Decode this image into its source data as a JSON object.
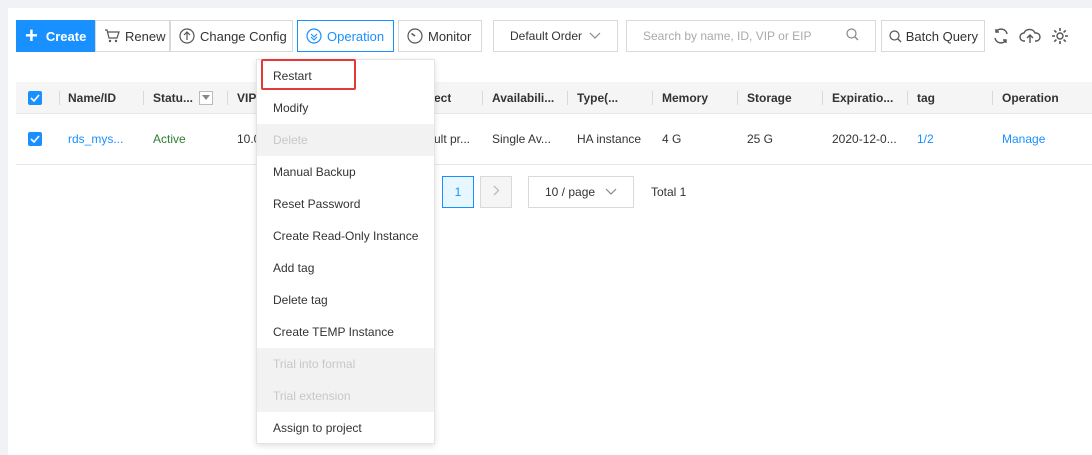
{
  "toolbar": {
    "create_label": "Create",
    "renew_label": "Renew",
    "change_config_label": "Change Config",
    "operation_label": "Operation",
    "monitor_label": "Monitor",
    "order_select_value": "Default Order",
    "search_placeholder": "Search by name, ID, VIP or EIP",
    "batch_query_label": "Batch Query"
  },
  "table": {
    "headers": {
      "name": "Name/ID",
      "status": "Statu...",
      "vip": "VIP",
      "project": "ect",
      "availability": "Availabili...",
      "type": "Type(...",
      "memory": "Memory",
      "storage": "Storage",
      "expiration": "Expiratio...",
      "tag": "tag",
      "operation": "Operation"
    },
    "row": {
      "name": "rds_mys...",
      "status": "Active",
      "vip": "10.0",
      "project": "ult pr...",
      "availability": "Single Av...",
      "type": "HA instance",
      "memory": "4 G",
      "storage": "25 G",
      "expiration": "2020-12-0...",
      "tag": "1/2",
      "operation": "Manage"
    }
  },
  "pagination": {
    "current_page": "1",
    "page_size": "10 / page",
    "total": "Total 1"
  },
  "menu": {
    "items": [
      {
        "label": "Restart"
      },
      {
        "label": "Modify"
      },
      {
        "label": "Delete"
      },
      {
        "label": "Manual Backup"
      },
      {
        "label": "Reset Password"
      },
      {
        "label": "Create Read-Only Instance"
      },
      {
        "label": "Add tag"
      },
      {
        "label": "Delete tag"
      },
      {
        "label": "Create TEMP Instance"
      },
      {
        "label": "Trial into formal"
      },
      {
        "label": "Trial extension"
      },
      {
        "label": "Assign to project"
      }
    ]
  },
  "colors": {
    "primary": "#1890ff",
    "active_status": "#2e7d32",
    "highlight": "#e53935",
    "disabled_text": "#c8c8c8"
  }
}
